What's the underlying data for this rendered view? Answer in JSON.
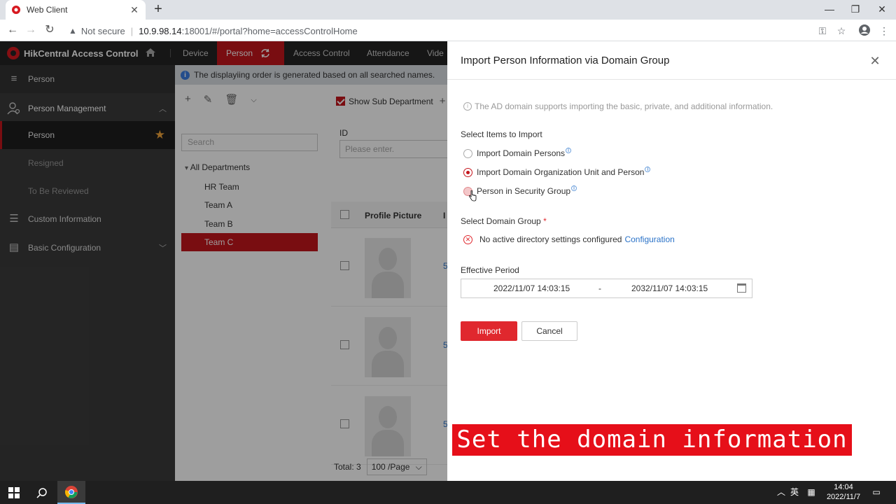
{
  "browser": {
    "tab_title": "Web Client",
    "tab_close": "✕",
    "new_tab": "+",
    "url_warning": "Not secure",
    "url_separator": "|",
    "url_host": "10.9.98.14",
    "url_path": ":18001/#/portal?home=accessControlHome",
    "window_minimize": "—",
    "window_restore": "❐",
    "window_close": "✕"
  },
  "app": {
    "brand": "HikCentral Access Control",
    "nav_tabs": [
      {
        "label": "Device"
      },
      {
        "label": "Person"
      },
      {
        "label": "Access Control"
      },
      {
        "label": "Attendance"
      },
      {
        "label": "Vide"
      }
    ]
  },
  "sidebar": {
    "header": "Person",
    "group": "Person Management",
    "items": [
      {
        "label": "Person"
      },
      {
        "label": "Resigned"
      },
      {
        "label": "To Be Reviewed"
      }
    ],
    "custom_info": "Custom Information",
    "basic_config": "Basic Configuration"
  },
  "main": {
    "notice": "The displayiing order is generated based on all searched names.",
    "search_placeholder": "Search",
    "tree_root": "All Departments",
    "departments": [
      {
        "label": "HR Team"
      },
      {
        "label": "Team A"
      },
      {
        "label": "Team B"
      },
      {
        "label": "Team C"
      }
    ],
    "show_sub_department": "Show Sub Department",
    "id_label": "ID",
    "id_placeholder": "Please enter.",
    "col_profile_picture": "Profile Picture",
    "col_next": "I",
    "row_id_prefix": "5",
    "total": "Total: 3",
    "page_size": "100 /Page"
  },
  "dialog": {
    "title": "Import Person Information via Domain Group",
    "info": "The AD domain supports importing the basic, private, and additional information.",
    "select_items_label": "Select Items to Import",
    "options": [
      {
        "label": "Import Domain Persons",
        "selected": false
      },
      {
        "label": "Import Domain Organization Unit and Person",
        "selected": true
      },
      {
        "label": "Person in Security Group",
        "selected": false
      }
    ],
    "domain_group_label": "Select Domain Group",
    "required_mark": "*",
    "error_text": "No active directory settings configured",
    "config_link": "Configuration",
    "effective_period_label": "Effective Period",
    "period_start": "2022/11/07 14:03:15",
    "period_separator": "-",
    "period_end": "2032/11/07 14:03:15",
    "import_button": "Import",
    "cancel_button": "Cancel"
  },
  "caption": "Set the domain information first",
  "taskbar": {
    "ime": "英",
    "time": "14:04",
    "date": "2022/11/7"
  },
  "colors": {
    "brand_red": "#c4151c",
    "button_red": "#e0282e",
    "link_blue": "#2b73c8",
    "caption_red": "#e60f19"
  }
}
